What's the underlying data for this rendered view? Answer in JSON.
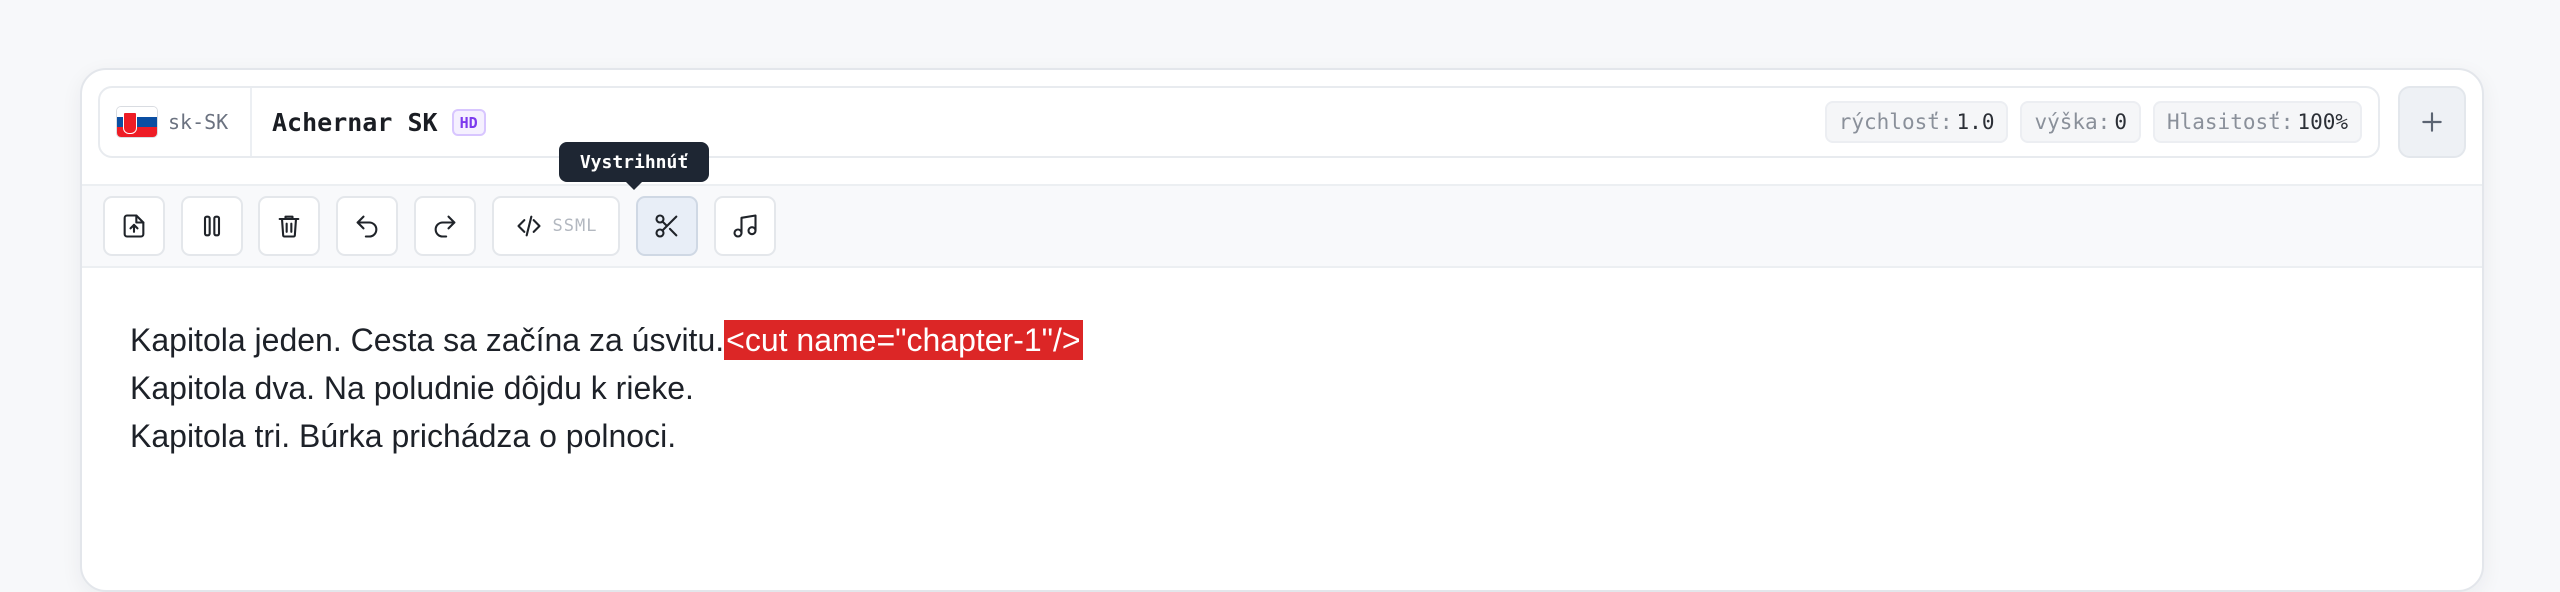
{
  "header": {
    "flag_icon": "slovakia-flag-icon",
    "language_code": "sk-SK",
    "voice_name": "Achernar SK",
    "quality_badge": "HD",
    "params": [
      {
        "key": "rýchlosť:",
        "value": "1.0"
      },
      {
        "key": "výška:",
        "value": "0"
      },
      {
        "key": "Hlasitosť:",
        "value": "100%"
      }
    ],
    "add_icon": "plus-icon"
  },
  "toolbar": {
    "buttons": [
      {
        "icon": "file-upload-icon"
      },
      {
        "icon": "pause-icon"
      },
      {
        "icon": "trash-icon"
      },
      {
        "icon": "undo-icon"
      },
      {
        "icon": "redo-icon"
      },
      {
        "icon": "code-icon",
        "label": "SSML"
      },
      {
        "icon": "scissors-icon",
        "active": true
      },
      {
        "icon": "music-note-icon"
      }
    ],
    "tooltip": "Vystrihnúť"
  },
  "editor": {
    "lines": [
      "Kapitola jeden. Cesta sa začína za úsvitu.",
      "Kapitola dva. Na poludnie dôjdu k rieke.",
      "Kapitola tri. Búrka prichádza o polnoci."
    ],
    "cut_tag": "<cut name=\"chapter-1\"/>"
  },
  "colors": {
    "cut_tag_bg": "#dc2626",
    "hd_badge": "#7c3aed",
    "tooltip_bg": "#1e2633"
  }
}
